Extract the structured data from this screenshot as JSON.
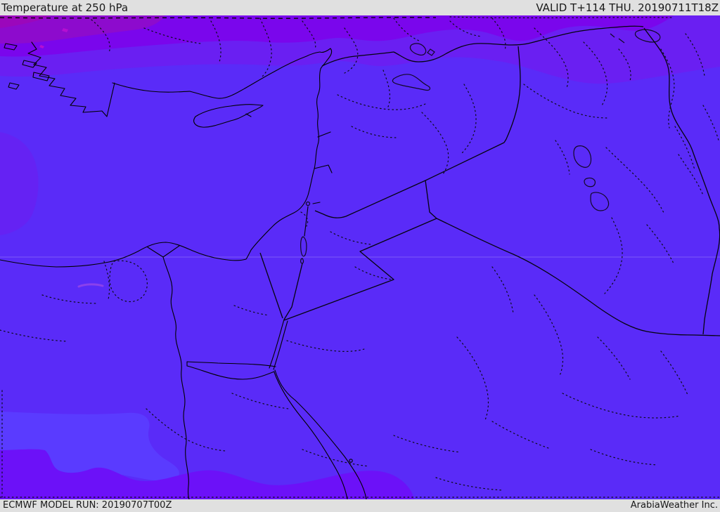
{
  "header": {
    "title": "Temperature at 250 hPa",
    "validity": "VALID T+114 THU. 20190711T18Z"
  },
  "footer": {
    "model_run": "ECMWF MODEL RUN: 20190707T00Z",
    "credit": "ArabiaWeather Inc."
  },
  "map": {
    "parameter": "Temperature",
    "level": "250 hPa",
    "palette": {
      "base": "#5a2bf8",
      "band_mid": "#6a1ff2",
      "band_purple": "#7a06ec",
      "band_dark": "#8d0bcd",
      "band_darkest": "#9b07bb",
      "patch_left": "#6522f3",
      "patch_cool_blue": "#5a3bff",
      "patch_cool_purple": "#6c11f8",
      "lagoon_magenta": "#9747e8",
      "magenta_spot": "#b50fd2",
      "boundary_line": "#000000",
      "frame_gray": "#e0e0e0"
    }
  }
}
